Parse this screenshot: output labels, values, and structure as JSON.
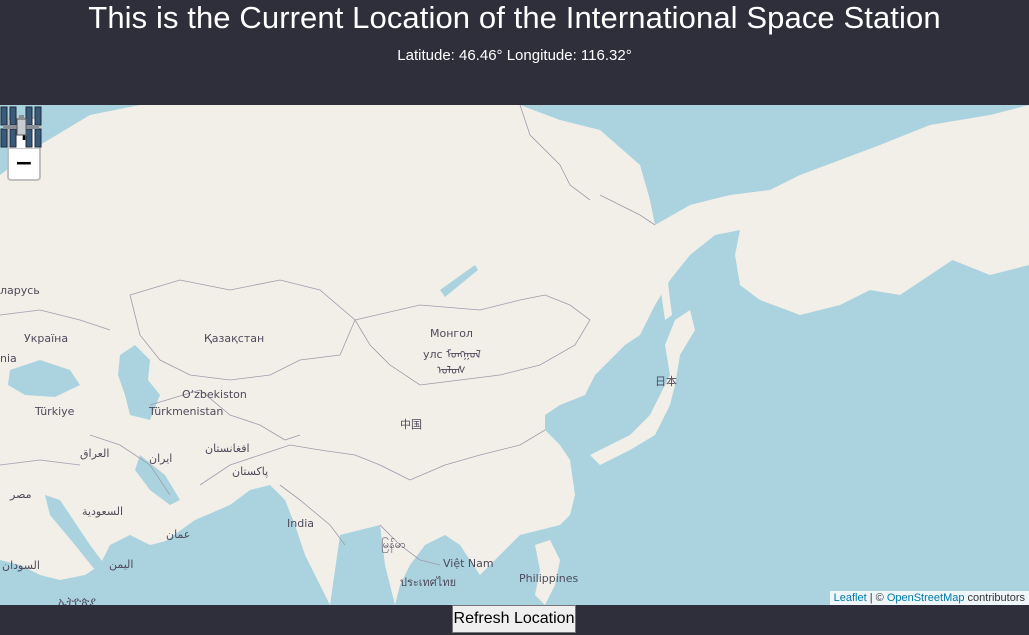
{
  "header": {
    "title": "This is the Current Location of the International Space Station",
    "coordinates": "Latitude: 46.46° Longitude: 116.32°"
  },
  "iss": {
    "latitude": 46.46,
    "longitude": 116.32,
    "marker_icon": "space-station-icon"
  },
  "map": {
    "zoom_in_label": "+",
    "zoom_out_label": "−",
    "labels": {
      "belarus": "ларусь",
      "ukraine": "Україна",
      "ukraine2": "nia",
      "kazakhstan": "Қазақстан",
      "mongolia1": "Монгол",
      "mongolia2": "улс ᠮᠣᠩᠭᠣᠯ",
      "mongolia3": "ᠤᠯᠤᠰ",
      "uzbekistan": "O‘zbekiston",
      "turkiye": "Türkiye",
      "turkmenistan": "Türkmenistan",
      "iraq": "العراق",
      "iran": "ایران",
      "afghanistan": "افغانستان",
      "pakistan": "پاکستان",
      "china": "中国",
      "japan": "日本",
      "egypt": "مصر",
      "saudi": "السعودية",
      "oman": "عمان",
      "india": "India",
      "myanmar": "မြန်မာ",
      "sudan": "السودان",
      "yemen": "اليمن",
      "vietnam": "Việt Nam",
      "thailand": "ประเทศไทย",
      "philippines": "Philippines",
      "ethiopia": "ኢትዮጵያ"
    },
    "attribution": {
      "leaflet": "Leaflet",
      "separator": " | © ",
      "osm": "OpenStreetMap",
      "contributors": " contributors"
    }
  },
  "footer": {
    "refresh_label": "Refresh Location"
  },
  "colors": {
    "background": "#2f2e3b",
    "water": "#aad3df",
    "land": "#f2efe9",
    "border": "#9e9cab"
  }
}
